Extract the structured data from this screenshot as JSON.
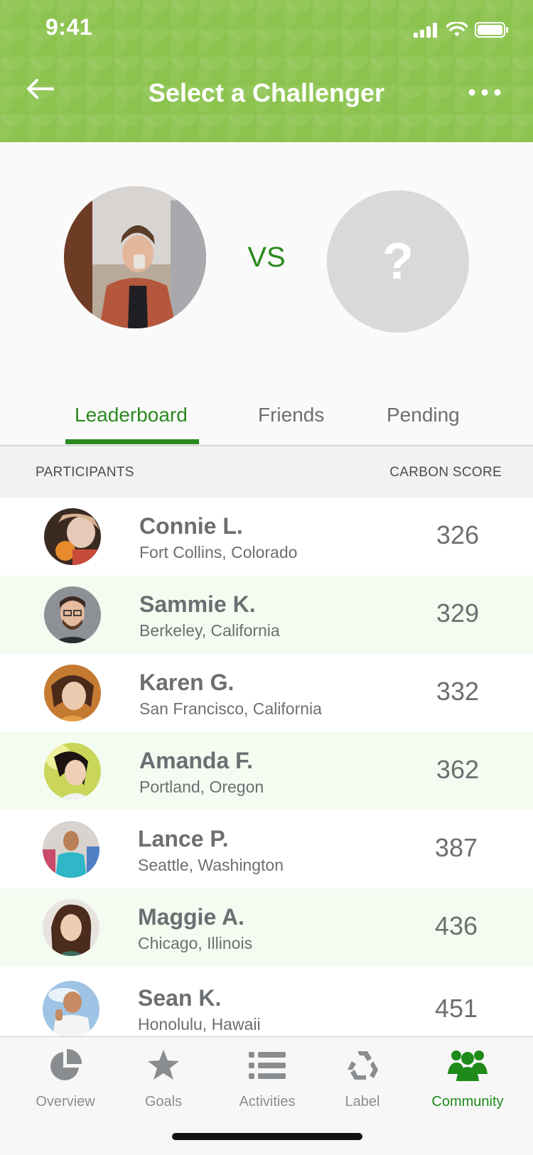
{
  "status_bar": {
    "time": "9:41"
  },
  "header": {
    "title": "Select a Challenger",
    "back_icon": "back-arrow-icon",
    "more_icon": "more-dots-icon",
    "color": "#8cc34f"
  },
  "challenge": {
    "vs_label": "VS",
    "placeholder_symbol": "?"
  },
  "tabs": [
    {
      "label": "Leaderboard",
      "active": true
    },
    {
      "label": "Friends",
      "active": false
    },
    {
      "label": "Pending",
      "active": false
    }
  ],
  "columns": {
    "participants": "PARTICIPANTS",
    "score": "CARBON SCORE"
  },
  "participants": [
    {
      "name": "Connie L.",
      "location": "Fort Collins, Colorado",
      "score": "326"
    },
    {
      "name": "Sammie K.",
      "location": "Berkeley, California",
      "score": "329"
    },
    {
      "name": "Karen G.",
      "location": "San Francisco, California",
      "score": "332"
    },
    {
      "name": "Amanda F.",
      "location": "Portland, Oregon",
      "score": "362"
    },
    {
      "name": "Lance P.",
      "location": "Seattle, Washington",
      "score": "387"
    },
    {
      "name": "Maggie A.",
      "location": "Chicago, Illinois",
      "score": "436"
    },
    {
      "name": "Sean K.",
      "location": "Honolulu, Hawaii",
      "score": "451"
    }
  ],
  "bottom_nav": [
    {
      "label": "Overview",
      "icon": "pie-chart-icon",
      "active": false
    },
    {
      "label": "Goals",
      "icon": "star-icon",
      "active": false
    },
    {
      "label": "Activities",
      "icon": "list-icon",
      "active": false
    },
    {
      "label": "Label",
      "icon": "recycle-icon",
      "active": false
    },
    {
      "label": "Community",
      "icon": "community-icon",
      "active": true
    }
  ],
  "colors": {
    "accent": "#2a8a1f",
    "active_nav": "#1e8a1a",
    "row_alt": "#f4fbf0"
  }
}
